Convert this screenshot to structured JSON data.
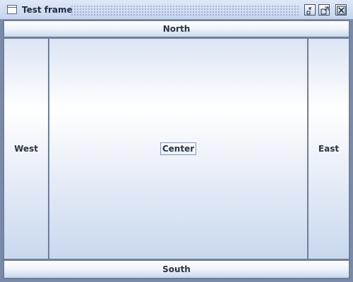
{
  "window": {
    "title": "Test frame",
    "controls": [
      "iconify-icon",
      "maximize-icon",
      "close-icon"
    ]
  },
  "layout": {
    "north": "North",
    "south": "South",
    "west": "West",
    "center": "Center",
    "east": "East"
  },
  "colors": {
    "titlebar": "#c5d4ee",
    "panel_border": "#6f7f99",
    "text": "#2b3444"
  }
}
